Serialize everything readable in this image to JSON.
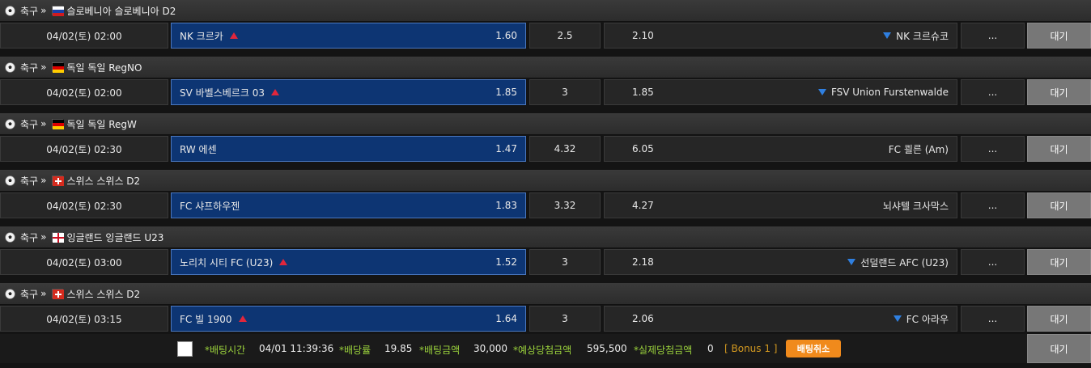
{
  "breadcrumb_sep": "»",
  "sections": [
    {
      "sport": "축구",
      "flag": "slovenia",
      "league": "슬로베니아 슬로베니아 D2",
      "match": {
        "time": "04/02(토) 02:00",
        "home": "NK 크르카",
        "home_odds": "1.60",
        "home_arrow": "up",
        "draw": "2.5",
        "away_odds": "2.10",
        "away": "NK 크르슈코",
        "away_arrow": "down",
        "more": "...",
        "status": "대기"
      }
    },
    {
      "sport": "축구",
      "flag": "germany",
      "league": "독일 독일 RegNO",
      "match": {
        "time": "04/02(토) 02:00",
        "home": "SV 바벨스베르크 03",
        "home_odds": "1.85",
        "home_arrow": "up",
        "draw": "3",
        "away_odds": "1.85",
        "away": "FSV Union Furstenwalde",
        "away_arrow": "down",
        "more": "...",
        "status": "대기"
      }
    },
    {
      "sport": "축구",
      "flag": "germany",
      "league": "독일 독일 RegW",
      "match": {
        "time": "04/02(토) 02:30",
        "home": "RW 에센",
        "home_odds": "1.47",
        "home_arrow": "",
        "draw": "4.32",
        "away_odds": "6.05",
        "away": "FC 쾰른 (Am)",
        "away_arrow": "",
        "more": "...",
        "status": "대기"
      }
    },
    {
      "sport": "축구",
      "flag": "switzerland",
      "league": "스위스 스위스 D2",
      "match": {
        "time": "04/02(토) 02:30",
        "home": "FC 샤프하우젠",
        "home_odds": "1.83",
        "home_arrow": "",
        "draw": "3.32",
        "away_odds": "4.27",
        "away": "뇌샤텔 크사막스",
        "away_arrow": "",
        "more": "...",
        "status": "대기"
      }
    },
    {
      "sport": "축구",
      "flag": "england",
      "league": "잉글랜드 잉글랜드 U23",
      "match": {
        "time": "04/02(토) 03:00",
        "home": "노리치 시티 FC (U23)",
        "home_odds": "1.52",
        "home_arrow": "up",
        "draw": "3",
        "away_odds": "2.18",
        "away": "선덜랜드 AFC (U23)",
        "away_arrow": "down",
        "more": "...",
        "status": "대기"
      }
    },
    {
      "sport": "축구",
      "flag": "switzerland",
      "league": "스위스 스위스 D2",
      "match": {
        "time": "04/02(토) 03:15",
        "home": "FC 빌 1900",
        "home_odds": "1.64",
        "home_arrow": "up",
        "draw": "3",
        "away_odds": "2.06",
        "away": "FC 아라우",
        "away_arrow": "down",
        "more": "...",
        "status": "대기"
      }
    }
  ],
  "footer": {
    "bet_time_label": "*배팅시간",
    "bet_time": "04/01 11:39:36",
    "odds_label": "*배당률",
    "odds": "19.85",
    "amount_label": "*배팅금액",
    "amount": "30,000",
    "expected_label": "*예상당첨금액",
    "expected": "595,500",
    "actual_label": "*실제당첨금액",
    "actual": "0",
    "bonus": "[ Bonus 1 ]",
    "cancel_label": "배팅취소",
    "status": "대기"
  }
}
